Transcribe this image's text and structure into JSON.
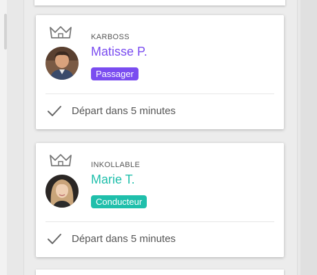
{
  "colors": {
    "purple": "#7a4cf0",
    "teal": "#1fbfab",
    "text_secondary": "#555555"
  },
  "cards": [
    {
      "nickname": "KARBOSS",
      "name": "Matisse P.",
      "role": "Passager",
      "status": "Départ dans 5 minutes",
      "crown_icon": "crown-icon",
      "check_icon": "check-icon"
    },
    {
      "nickname": "INKOLLABLE",
      "name": "Marie T.",
      "role": "Conducteur",
      "status": "Départ dans 5 minutes",
      "crown_icon": "crown-icon",
      "check_icon": "check-icon"
    }
  ]
}
